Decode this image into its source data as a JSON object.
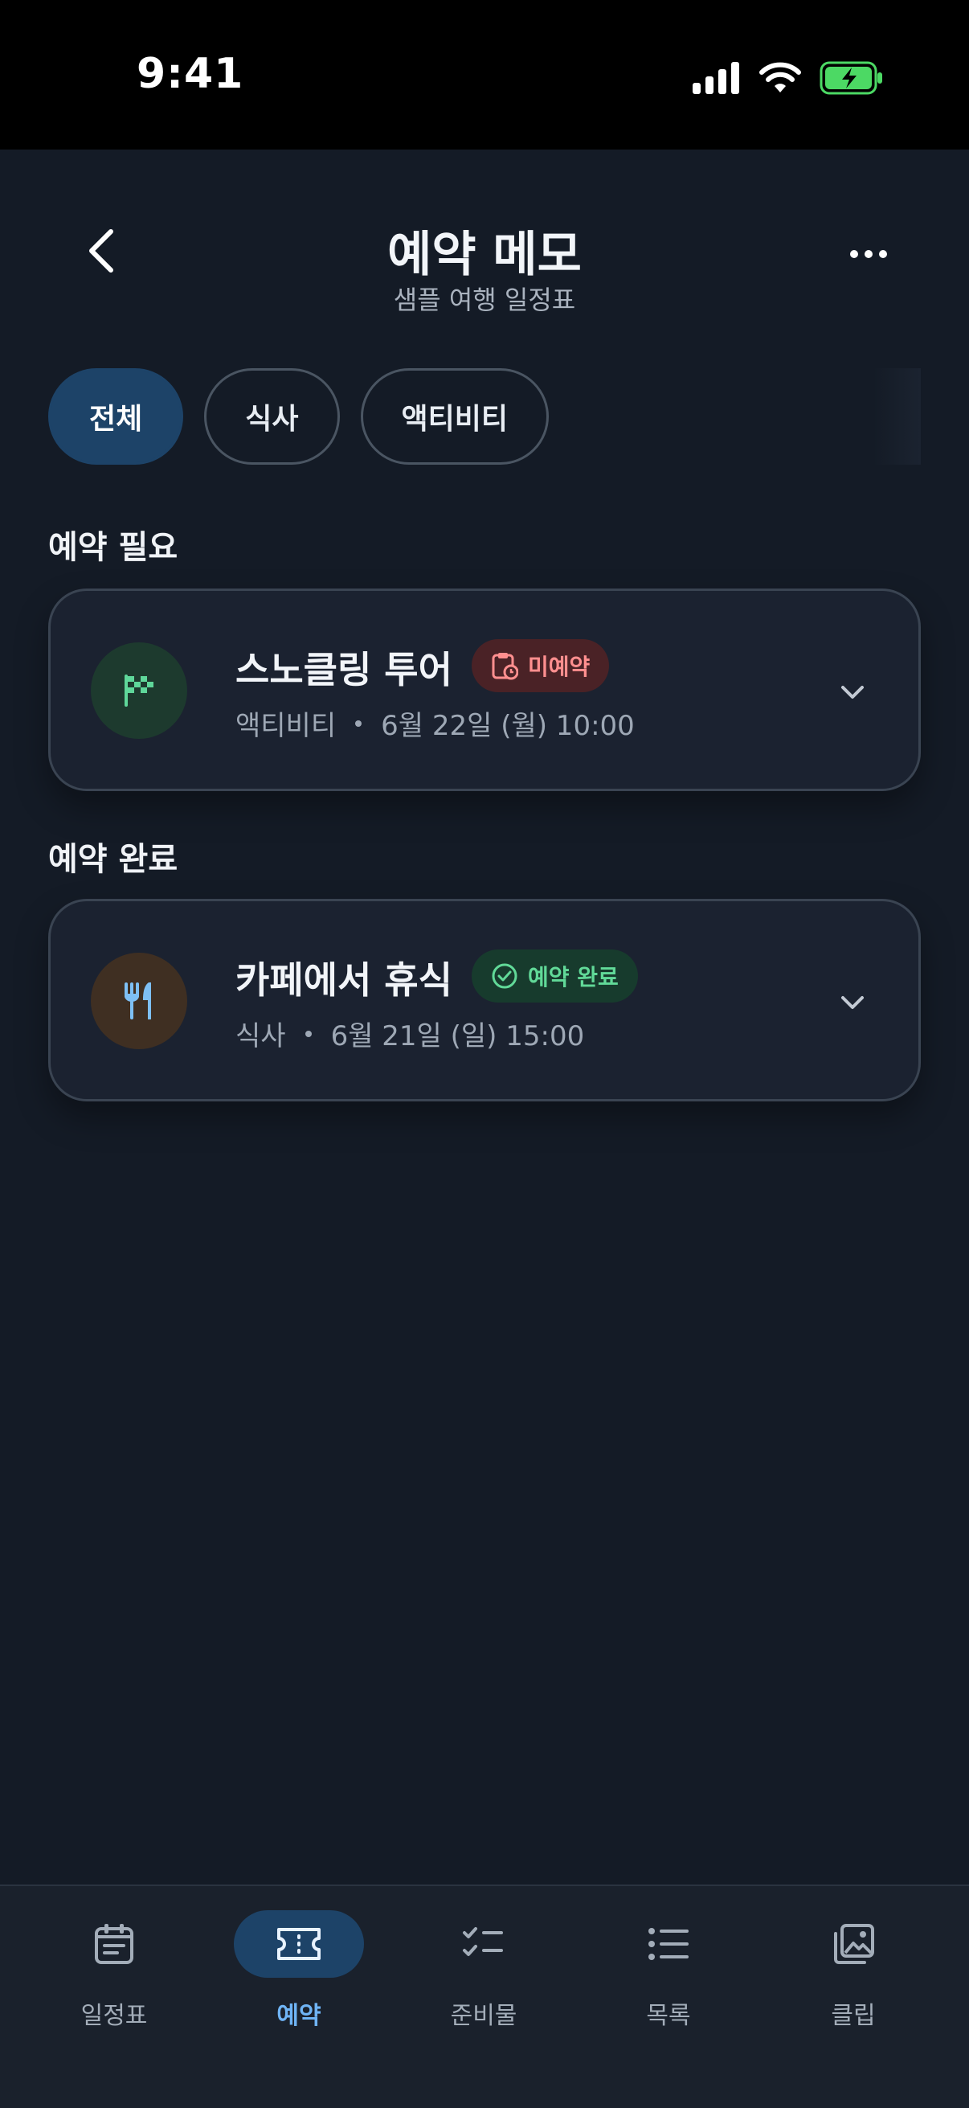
{
  "status_bar": {
    "time": "9:41"
  },
  "header": {
    "title": "예약 메모",
    "subtitle": "샘플 여행 일정표"
  },
  "filters": [
    {
      "label": "전체",
      "active": true
    },
    {
      "label": "식사",
      "active": false
    },
    {
      "label": "액티비티",
      "active": false
    }
  ],
  "sections": [
    {
      "title": "예약 필요",
      "items": [
        {
          "title": "스노클링 투어",
          "badge": "미예약",
          "category": "액티비티",
          "datetime": "6월 22일 (월) 10:00"
        }
      ]
    },
    {
      "title": "예약 완료",
      "items": [
        {
          "title": "카페에서 휴식",
          "badge": "예약 완료",
          "category": "식사",
          "datetime": "6월 21일 (일) 15:00"
        }
      ]
    }
  ],
  "bottom_nav": [
    {
      "label": "일정표",
      "icon": "calendar-icon",
      "active": false
    },
    {
      "label": "예약",
      "icon": "ticket-icon",
      "active": true
    },
    {
      "label": "준비물",
      "icon": "checklist-icon",
      "active": false
    },
    {
      "label": "목록",
      "icon": "list-icon",
      "active": false
    },
    {
      "label": "클립",
      "icon": "gallery-icon",
      "active": false
    }
  ],
  "colors": {
    "background": "#141b26",
    "accent": "#1d4368",
    "accent_text": "#6fb4f5",
    "pending_badge": "#ff8f8f",
    "done_badge": "#61d998"
  }
}
